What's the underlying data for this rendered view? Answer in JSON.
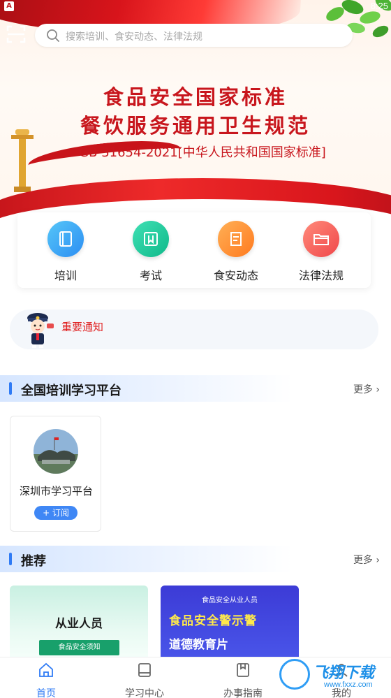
{
  "status_bar": {
    "time": "8:25"
  },
  "search": {
    "placeholder": "搜索培训、食安动态、法律法规"
  },
  "banner": {
    "title_line1": "食品安全国家标准",
    "title_line2": "餐饮服务通用卫生规范",
    "subtitle": "GB 31654-2021[中华人民共和国国家标准]"
  },
  "quick_menu": [
    {
      "label": "培训",
      "icon": "book-icon",
      "color": "#2c8ef3"
    },
    {
      "label": "考试",
      "icon": "exam-icon",
      "color": "#10b98a"
    },
    {
      "label": "食安动态",
      "icon": "news-icon",
      "color": "#ff7a1f"
    },
    {
      "label": "法律法规",
      "icon": "folder-icon",
      "color": "#f0474a"
    }
  ],
  "notice": {
    "label": "重要通知"
  },
  "section_platform": {
    "title": "全国培训学习平台",
    "more": "更多"
  },
  "platform": {
    "name": "深圳市学习平台",
    "subscribe": "+ 订阅"
  },
  "section_recommend": {
    "title": "推荐",
    "more": "更多"
  },
  "recommend": [
    {
      "title": "从业人员",
      "button": "食品安全须知"
    },
    {
      "top": "食品安全从业人员",
      "main": "食品安全警示警",
      "sub": "道德教育片"
    }
  ],
  "bottom_nav": [
    {
      "label": "首页",
      "active": true
    },
    {
      "label": "学习中心",
      "active": false
    },
    {
      "label": "办事指南",
      "active": false
    },
    {
      "label": "我的",
      "active": false
    }
  ],
  "watermark": {
    "text": "飞翔下载",
    "url": "www.fxxz.com"
  },
  "colors": {
    "accent": "#2f7bf5",
    "brand_red": "#c8161d",
    "notice_red": "#e02020"
  }
}
